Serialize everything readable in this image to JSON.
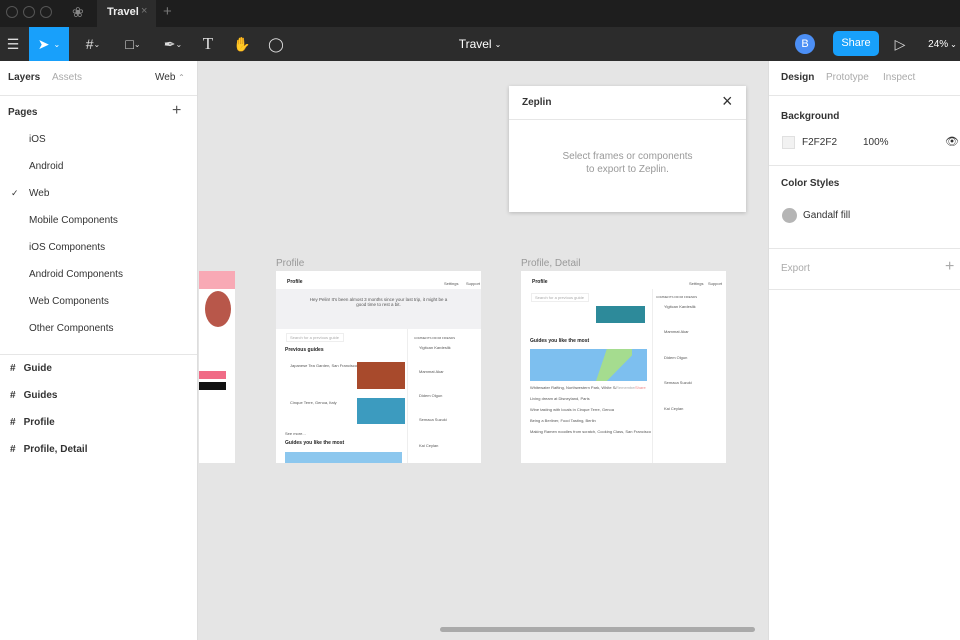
{
  "tabbar": {
    "tab_title": "Travel"
  },
  "toolbar": {
    "file_title": "Travel",
    "avatar_initial": "B",
    "share_label": "Share",
    "zoom": "24%"
  },
  "left_panel": {
    "tabs": [
      "Layers",
      "Assets"
    ],
    "page_selector": "Web",
    "pages_title": "Pages",
    "pages": [
      "iOS",
      "Android",
      "Web",
      "Mobile Components",
      "iOS Components",
      "Android Components",
      "Web Components",
      "Other Components"
    ],
    "selected_page": "Web",
    "layers": [
      "Guide",
      "Guides",
      "Profile",
      "Profile, Detail"
    ]
  },
  "zeplin": {
    "title": "Zeplin",
    "message_line1": "Select frames or components",
    "message_line2": "to export to Zeplin."
  },
  "canvas": {
    "frames": [
      {
        "label": "Profile",
        "header": "Profile",
        "nav": [
          "Settings",
          "Support"
        ],
        "greeting": "Hey Pelin! It's been almost 3 months since your last trip, it might be a good time to rest a bit.",
        "search": "Search for a previous guide",
        "previous_guides": "Previous guides",
        "guides": [
          "Japanese Tea Garden, San Francisco",
          "Cinque Terre, Genoa, Italy"
        ],
        "see_more": "See more...",
        "most_liked": "Guides you like the most",
        "comments_title": "COMMENTS FROM FRIENDS",
        "friends": [
          "Yigitcan Kardeslik",
          "Mammat Akar",
          "Didem Olgun",
          "Semaca Suzuki",
          "Kai Ceylan"
        ]
      },
      {
        "label": "Profile, Detail",
        "header": "Profile",
        "nav": [
          "Settings",
          "Support"
        ],
        "search": "Search for a previous guide",
        "most_liked": "Guides you like the most",
        "list": [
          "Whitewater Rafting, Northwestern Park, White Salmon, WA",
          "Living dream at Disneyland, Paris",
          "Wine tasting with locals in Cinque Terre, Genoa",
          "Being a Berliner, Food Tasting, Berlin",
          "Making Ramen noodles from scratch, Cooking Class, San Francisco"
        ],
        "list_actions": [
          "Remember",
          "Share"
        ],
        "comments_title": "COMMENTS FROM FRIENDS",
        "friends": [
          "Yigitcan Kardeslik",
          "Mammat Akar",
          "Didem Olgun",
          "Semaca Suzuki",
          "Kai Ceylan"
        ]
      }
    ]
  },
  "right_panel": {
    "tabs": [
      "Design",
      "Prototype",
      "Inspect"
    ],
    "background_title": "Background",
    "bg_hex": "F2F2F2",
    "bg_opacity": "100%",
    "color_styles_title": "Color Styles",
    "color_style": "Gandalf fill",
    "export_title": "Export"
  },
  "help": "?",
  "colors": {
    "accent": "#18a0fb",
    "dark": "#2c2c2c",
    "canvas": "#e5e5e5"
  }
}
